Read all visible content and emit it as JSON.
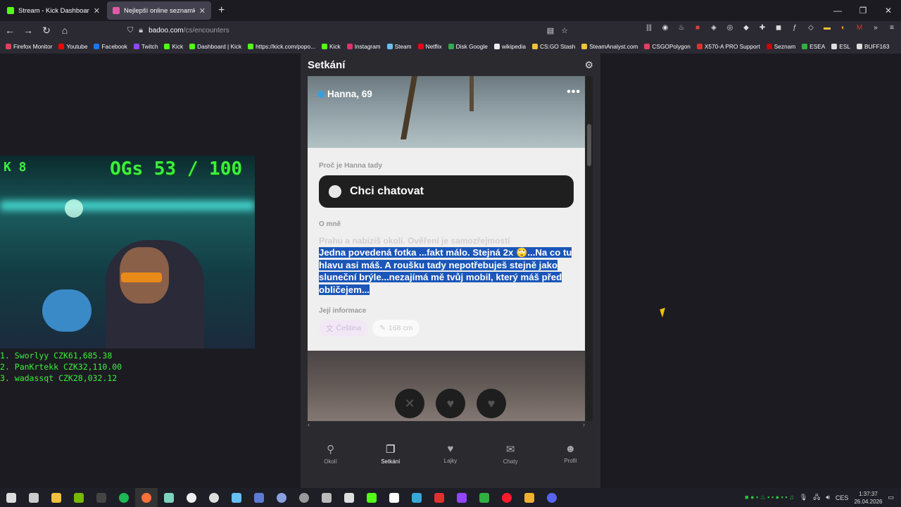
{
  "browser": {
    "tabs": [
      {
        "label": "Stream - Kick Dashboard",
        "favicon_color": "#53fc18"
      },
      {
        "label": "Nejlepší online seznamka zdarm",
        "favicon_color": "#e05aa7"
      }
    ],
    "new_tab": "+",
    "window_controls": {
      "minimize": "—",
      "maximize": "❐",
      "close": "✕"
    },
    "url": {
      "host": "badoo.com",
      "path": "/cs/encounters"
    },
    "bookmarks": [
      {
        "label": "Firefox Monitor",
        "color": "#e04060"
      },
      {
        "label": "Youtube",
        "color": "#ff0000"
      },
      {
        "label": "Facebook",
        "color": "#1877f2"
      },
      {
        "label": "Twitch",
        "color": "#9146ff"
      },
      {
        "label": "Kick",
        "color": "#53fc18"
      },
      {
        "label": "Dashboard | Kick",
        "color": "#53fc18"
      },
      {
        "label": "https://kick.com/popo...",
        "color": "#53fc18"
      },
      {
        "label": "Kick",
        "color": "#53fc18"
      },
      {
        "label": "Instagram",
        "color": "#e1306c"
      },
      {
        "label": "Steam",
        "color": "#66c0f4"
      },
      {
        "label": "Netflix",
        "color": "#e50914"
      },
      {
        "label": "Disk Google",
        "color": "#34a853"
      },
      {
        "label": "wikipedia",
        "color": "#eeeeee"
      },
      {
        "label": "CS:GO Stash",
        "color": "#f0c040"
      },
      {
        "label": "SteamAnalyst.com",
        "color": "#f0c040"
      },
      {
        "label": "CSGOPolygon",
        "color": "#e04060"
      },
      {
        "label": "X570-A PRO Support",
        "color": "#e03030"
      },
      {
        "label": "Seznam",
        "color": "#cc0000"
      },
      {
        "label": "ESEA",
        "color": "#30b040"
      },
      {
        "label": "ESL",
        "color": "#dddddd"
      },
      {
        "label": "BUFF163",
        "color": "#dddddd"
      }
    ]
  },
  "app": {
    "title": "Setkání",
    "profile": {
      "name": "Hanna, 69"
    },
    "why_label": "Proč je Hanna tady",
    "chat_button": "Chci chatovat",
    "about_label": "O mně",
    "ghost_text": "Prahu a nabízíš okolí. Ověření je samozřejmostí",
    "bio": "Jedna povedená fotka ...fakt málo. Stejná 2x 🙄...Na co tu hlavu asi máš. A roušku tady nepotřebuješ stejně jako sluneční brýle...nezajímá mě tvůj mobil, který máš před obličejem...",
    "her_info_label": "Její informace",
    "chips": [
      {
        "icon": "translate-icon",
        "label": "Čeština"
      },
      {
        "icon": "ruler-icon",
        "label": "168 cm"
      }
    ],
    "nav": [
      {
        "icon": "pin-icon",
        "label": "Okolí",
        "active": false
      },
      {
        "icon": "cards-icon",
        "label": "Setkání",
        "active": true
      },
      {
        "icon": "heart-icon",
        "label": "Lajky",
        "active": false
      },
      {
        "icon": "chat-icon",
        "label": "Chaty",
        "active": false
      },
      {
        "icon": "person-icon",
        "label": "Profil",
        "active": false
      }
    ]
  },
  "overlay": {
    "kick_badge": "K 8",
    "ogs": "OGs 53 / 100",
    "leaderboard": [
      "1. Sworlyy CZK61,685.38",
      "2. PanKrtekk CZK32,110.00",
      "3. wadassqt CZK28,032.12"
    ]
  },
  "taskbar": {
    "language": "CES",
    "time": "1:37:37",
    "date": "26.04.2026"
  }
}
